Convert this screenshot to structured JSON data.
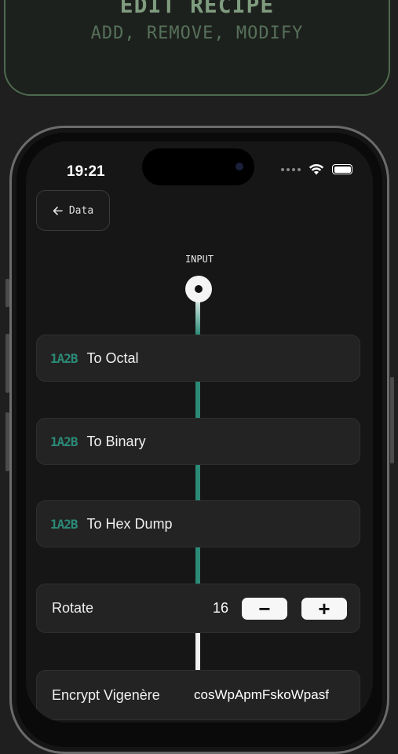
{
  "banner": {
    "title": "EDIT RECIPE",
    "subtitle": "ADD, REMOVE, MODIFY"
  },
  "status_bar": {
    "time": "19:21"
  },
  "nav": {
    "back_label": "Data",
    "back_icon": "arrow-left-icon"
  },
  "pipeline": {
    "input_label": "INPUT",
    "accent_color": "#2b8a77",
    "operations": [
      {
        "icon_text": "1A2B",
        "label": "To Octal"
      },
      {
        "icon_text": "1A2B",
        "label": "To Binary"
      },
      {
        "icon_text": "1A2B",
        "label": "To Hex Dump"
      }
    ],
    "rotate": {
      "label": "Rotate",
      "value": "16",
      "minus_label": "−",
      "plus_label": "+"
    },
    "vigenere": {
      "label": "Encrypt Vigenère",
      "key": "cosWpApmFskoWpasf"
    }
  }
}
